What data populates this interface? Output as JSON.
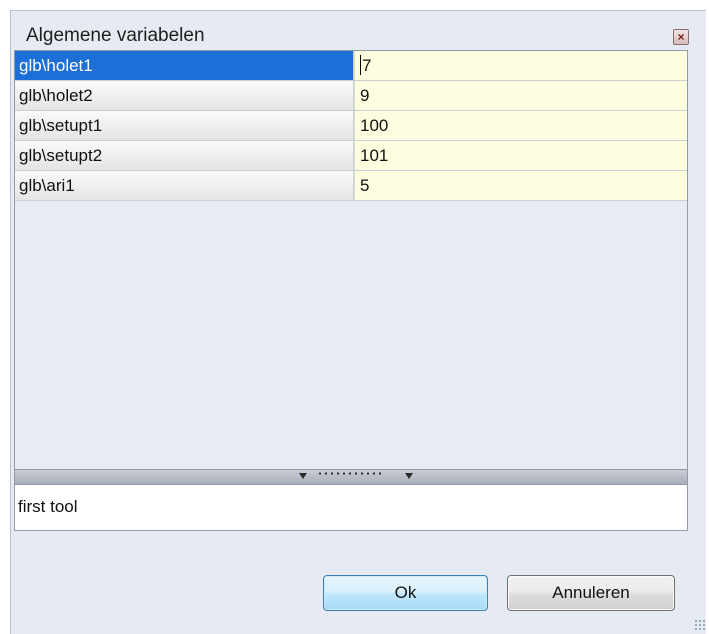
{
  "window": {
    "title": "Algemene variabelen",
    "close_icon": "close-icon"
  },
  "variables": [
    {
      "name": "glb\\holet1",
      "value": "7"
    },
    {
      "name": "glb\\holet2",
      "value": "9"
    },
    {
      "name": "glb\\setupt1",
      "value": "100"
    },
    {
      "name": "glb\\setupt2",
      "value": "101"
    },
    {
      "name": "glb\\ari1",
      "value": "5"
    }
  ],
  "selected_row": 0,
  "description": "first tool",
  "buttons": {
    "ok_label": "Ok",
    "cancel_label": "Annuleren"
  },
  "colors": {
    "selection": "#1c6fd6",
    "value_background": "#fffde0",
    "dialog_background": "#e6ebf3"
  }
}
